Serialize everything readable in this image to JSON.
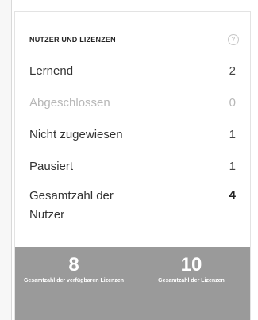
{
  "card": {
    "title": "NUTZER UND LIZENZEN",
    "help_icon": "question-circle-icon"
  },
  "rows": [
    {
      "label": "Lernend",
      "value": "2",
      "state": "normal"
    },
    {
      "label": "Abgeschlossen",
      "value": "0",
      "state": "muted"
    },
    {
      "label": "Nicht zugewiesen",
      "value": "1",
      "state": "normal"
    },
    {
      "label": "Pausiert",
      "value": "1",
      "state": "normal"
    },
    {
      "label": "Gesamtzahl der Nutzer",
      "value": "4",
      "state": "bold"
    }
  ],
  "summary": {
    "available": {
      "value": "8",
      "label": "Gesamtzahl der verfügbaren Lizenzen"
    },
    "total": {
      "value": "10",
      "label": "Gesamtzahl der Lizenzen"
    }
  },
  "colors": {
    "summary_background": "#9a9a9a",
    "muted_text": "#b7b7b7",
    "primary_text": "#333333"
  }
}
